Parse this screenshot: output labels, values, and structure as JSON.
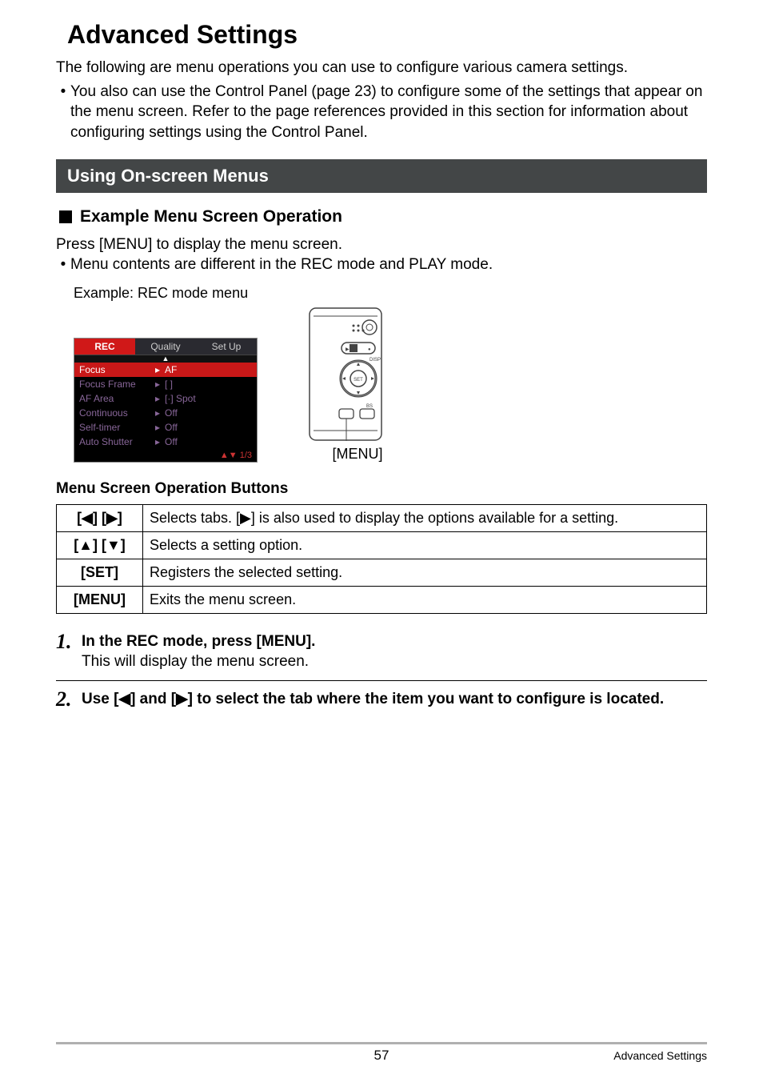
{
  "page_title": "Advanced Settings",
  "intro": "The following are menu operations you can use to configure various camera settings.",
  "intro_bullet": "You also can use the Control Panel (page 23) to configure some of the settings that appear on the menu screen. Refer to the page references provided in this section for information about configuring settings using the Control Panel.",
  "section_bar": "Using On-screen Menus",
  "subheading": "Example Menu Screen Operation",
  "press_menu": "Press [MENU] to display the menu screen.",
  "mode_bullet": "Menu contents are different in the REC mode and PLAY mode.",
  "example_label": "Example: REC mode menu",
  "menu_screenshot": {
    "tabs": [
      "REC",
      "Quality",
      "Set Up"
    ],
    "active_tab_index": 0,
    "items": [
      {
        "label": "Focus",
        "value": "AF",
        "highlight": true
      },
      {
        "label": "Focus Frame",
        "value": "[ ]"
      },
      {
        "label": "AF Area",
        "value": "[·] Spot"
      },
      {
        "label": "Continuous",
        "value": "Off"
      },
      {
        "label": "Self-timer",
        "value": "Off"
      },
      {
        "label": "Auto Shutter",
        "value": "Off"
      }
    ],
    "footer_left": "",
    "footer_right": "▲▼ 1/3"
  },
  "camera": {
    "label": "[MENU]",
    "buttons": {
      "set": "SET",
      "disp": "DISP",
      "bs": "BS"
    }
  },
  "op_heading": "Menu Screen Operation Buttons",
  "op_table": [
    {
      "key": "[◀] [▶]",
      "desc": "Selects tabs. [▶] is also used to display the options available for a setting."
    },
    {
      "key": "[▲] [▼]",
      "desc": "Selects a setting option."
    },
    {
      "key": "[SET]",
      "desc": "Registers the selected setting."
    },
    {
      "key": "[MENU]",
      "desc": "Exits the menu screen."
    }
  ],
  "steps": [
    {
      "num": "1.",
      "title": "In the REC mode, press [MENU].",
      "sub": "This will display the menu screen."
    },
    {
      "num": "2.",
      "title": "Use [◀] and [▶] to select the tab where the item you want to configure is located.",
      "sub": ""
    }
  ],
  "footer": {
    "page": "57",
    "section": "Advanced Settings"
  }
}
